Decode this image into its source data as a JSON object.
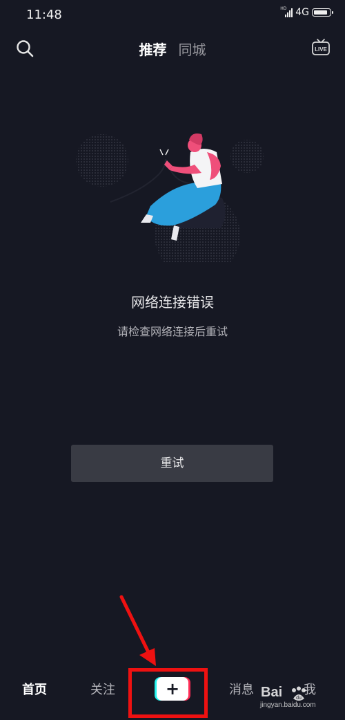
{
  "status_bar": {
    "time": "11:48",
    "network": "4G",
    "signal_label": "HD"
  },
  "top_nav": {
    "tabs": [
      {
        "label": "推荐",
        "active": true
      },
      {
        "label": "同城",
        "active": false
      }
    ],
    "live_label": "LIVE",
    "search_icon": "search-icon",
    "live_icon": "live-tv-icon"
  },
  "main": {
    "error_title": "网络连接错误",
    "error_subtitle": "请检查网络连接后重试",
    "retry_label": "重试"
  },
  "bottom_nav": {
    "items": [
      {
        "label": "首页",
        "active": true
      },
      {
        "label": "关注",
        "active": false
      },
      {
        "label": "+",
        "active": false
      },
      {
        "label": "消息",
        "active": false
      },
      {
        "label": "我",
        "active": false
      }
    ]
  },
  "watermark": {
    "brand": "Bai",
    "brand_du": "du",
    "subtitle": "jingyan.baidu.com"
  },
  "colors": {
    "background": "#161823",
    "button_bg": "#393b44",
    "accent_red": "#fe2c55",
    "accent_cyan": "#25f4ee",
    "annotation": "#ee1111"
  }
}
